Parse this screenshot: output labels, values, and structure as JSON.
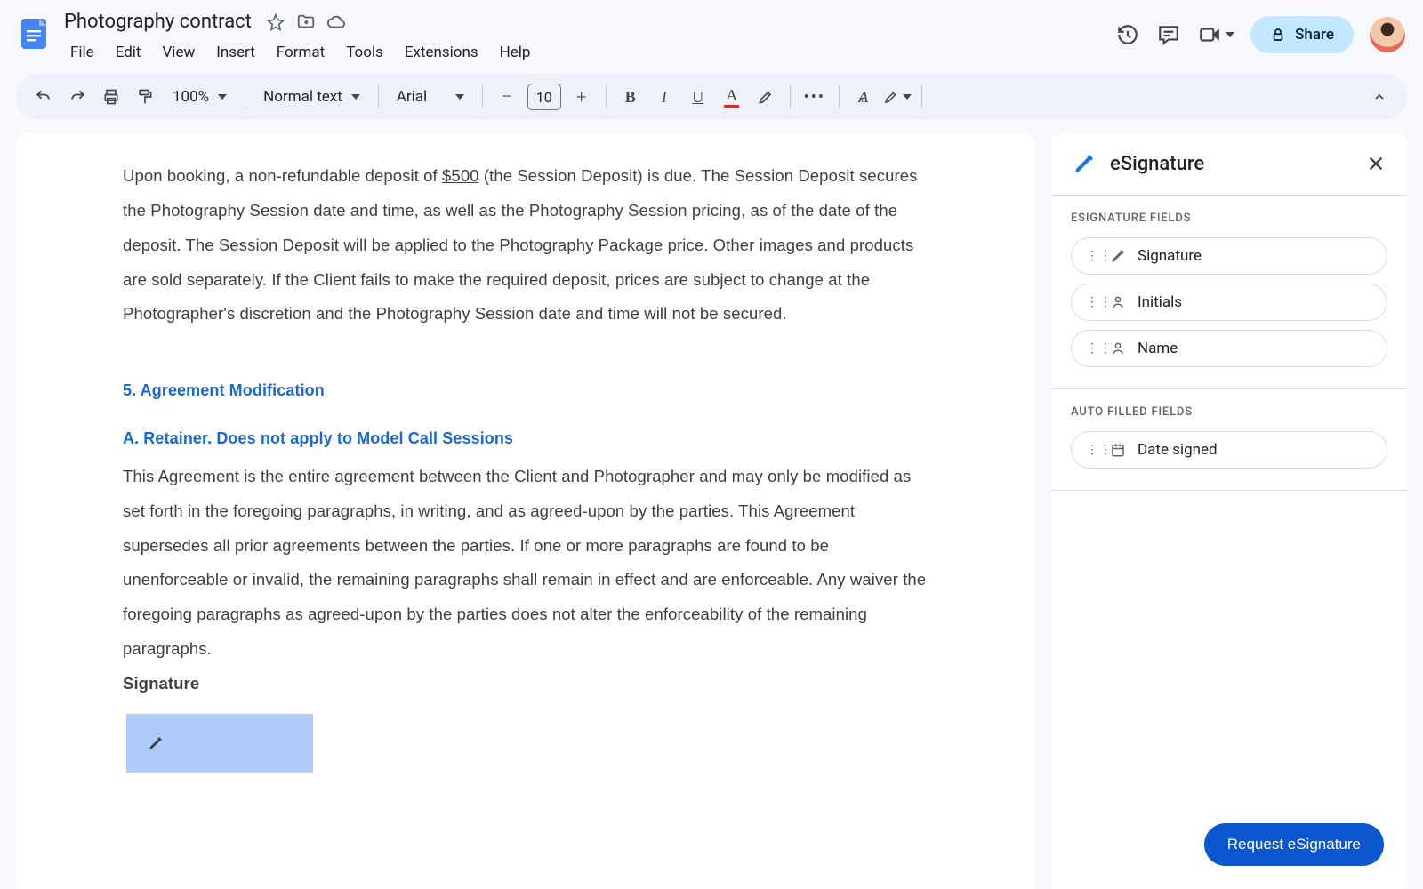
{
  "header": {
    "doc_title": "Photography contract",
    "menus": [
      "File",
      "Edit",
      "View",
      "Insert",
      "Format",
      "Tools",
      "Extensions",
      "Help"
    ],
    "share_label": "Share"
  },
  "toolbar": {
    "zoom": "100%",
    "style": "Normal text",
    "font": "Arial",
    "font_size": "10"
  },
  "document": {
    "para1_a": "Upon booking, a non-refundable deposit of ",
    "para1_amount": "$500",
    "para1_b": " (the Session Deposit) is due. The Session Deposit secures the Photography Session date and time, as well as the Photography Session pricing, as of the date of the deposit. The Session Deposit will be applied to the Photography Package price. Other images and products are sold separately. If the Client fails to make the required deposit, prices are subject to change at the Photographer's discretion and the Photography Session date and time will not be secured.",
    "heading5": "5. Agreement Modification",
    "sub_a": "A. Retainer.  Does not apply to Model Call Sessions",
    "para2": "This Agreement is the entire agreement between the Client and Photographer and may only be modified as set forth in the foregoing paragraphs, in writing, and as agreed-upon by the parties.  This Agreement supersedes all prior agreements between the parties. If one or more paragraphs are found to be unenforceable or invalid, the remaining paragraphs shall remain in effect and are enforceable. Any waiver the foregoing paragraphs as agreed-upon by the parties does not alter the enforceability of the remaining paragraphs.",
    "signature_label": "Signature"
  },
  "panel": {
    "title": "eSignature",
    "section1_label": "ESIGNATURE FIELDS",
    "fields": [
      "Signature",
      "Initials",
      "Name"
    ],
    "section2_label": "AUTO FILLED FIELDS",
    "auto_fields": [
      "Date signed"
    ],
    "request_label": "Request eSignature"
  },
  "colors": {
    "accent_blue": "#1a73e8",
    "share_bg": "#c2e7ff",
    "button_blue": "#0b57d0"
  }
}
